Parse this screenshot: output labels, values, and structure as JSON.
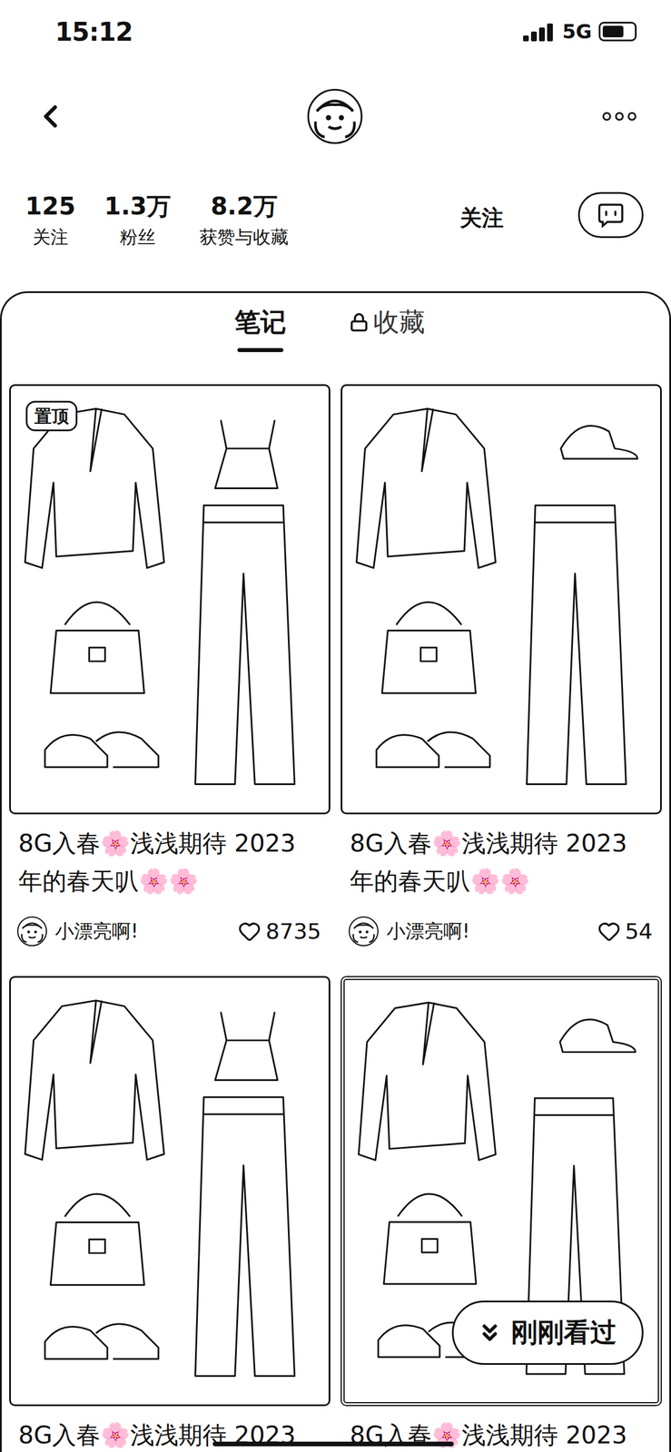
{
  "status_bar": {
    "time": "15:12",
    "network": "5G",
    "battery": 0.7
  },
  "profile": {
    "stats": [
      {
        "value": "125",
        "label": "关注"
      },
      {
        "value": "1.3万",
        "label": "粉丝"
      },
      {
        "value": "8.2万",
        "label": "获赞与收藏"
      }
    ],
    "follow_button": {
      "label": "关注"
    }
  },
  "tabs": [
    {
      "label": "笔记",
      "selected": true,
      "locked": false
    },
    {
      "label": "收藏",
      "selected": false,
      "locked": true
    }
  ],
  "notes": [
    {
      "title": "8G入春🌸浅浅期待 2023年的春天叭🌸🌸",
      "author": "小漂亮啊!",
      "likes": "8735",
      "liked": false,
      "badge": "置顶",
      "highlighted": false
    },
    {
      "title": "8G入春🌸浅浅期待 2023年的春天叭🌸🌸",
      "author": "小漂亮啊!",
      "likes": "54",
      "liked": false,
      "highlighted": false
    },
    {
      "title": "8G入春🌸浅浅期待 2023",
      "highlighted": false
    },
    {
      "title": "8G入春🌸浅浅期待 2023",
      "highlighted": true
    }
  ],
  "recent_button": {
    "label": "刚刚看过"
  }
}
